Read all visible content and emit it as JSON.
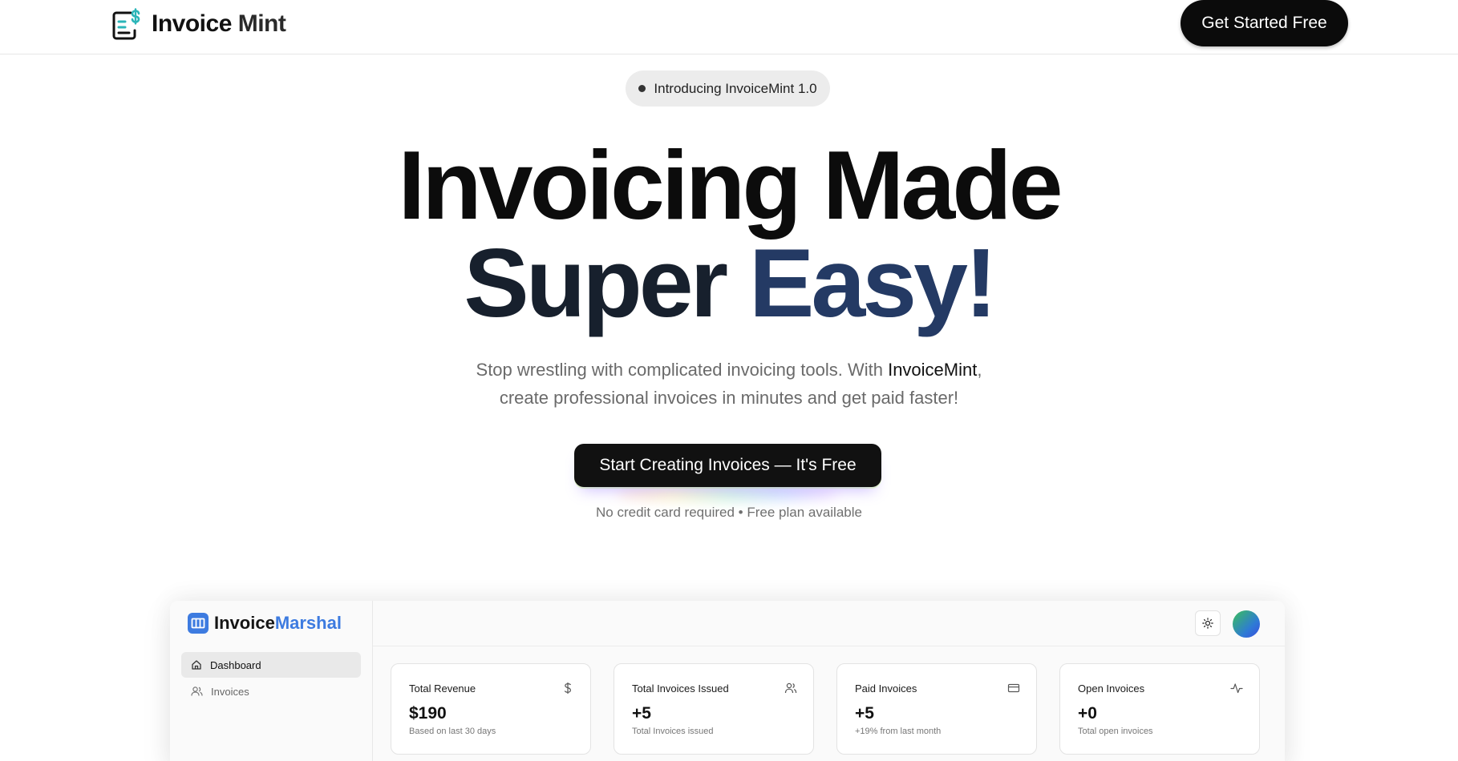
{
  "nav": {
    "brand_part1": "Invoice ",
    "brand_part2": "Mint",
    "cta_label": "Get Started Free"
  },
  "hero": {
    "badge": "Introducing InvoiceMint 1.0",
    "title_line1": "Invoicing Made",
    "title_line2_plain": "Super ",
    "title_line2_accent": "Easy!",
    "subtitle_line1_a": "Stop wrestling with complicated invoicing tools. With ",
    "subtitle_line1_brand": "InvoiceMint",
    "subtitle_line1_b": ",",
    "subtitle_line2": "create professional invoices in minutes and get paid faster!",
    "cta_label": "Start Creating Invoices — It's Free",
    "note": "No credit card required • Free plan available"
  },
  "dashboard": {
    "brand_part1": "Invoice",
    "brand_part2": "Marshal",
    "sidebar": [
      {
        "label": "Dashboard",
        "icon": "home-icon",
        "active": true
      },
      {
        "label": "Invoices",
        "icon": "users-icon",
        "active": false
      }
    ],
    "cards": [
      {
        "title": "Total Revenue",
        "value": "$190",
        "sub": "Based on last 30 days",
        "icon": "dollar-icon"
      },
      {
        "title": "Total Invoices Issued",
        "value": "+5",
        "sub": "Total Invoices issued",
        "icon": "users-icon"
      },
      {
        "title": "Paid Invoices",
        "value": "+5",
        "sub": "+19% from last month",
        "icon": "credit-card-icon"
      },
      {
        "title": "Open Invoices",
        "value": "+0",
        "sub": "Total open invoices",
        "icon": "activity-icon"
      }
    ]
  },
  "colors": {
    "accent_navy": "#243a64",
    "brand_teal": "#2bb5b8",
    "dashboard_blue": "#3d7be0"
  }
}
